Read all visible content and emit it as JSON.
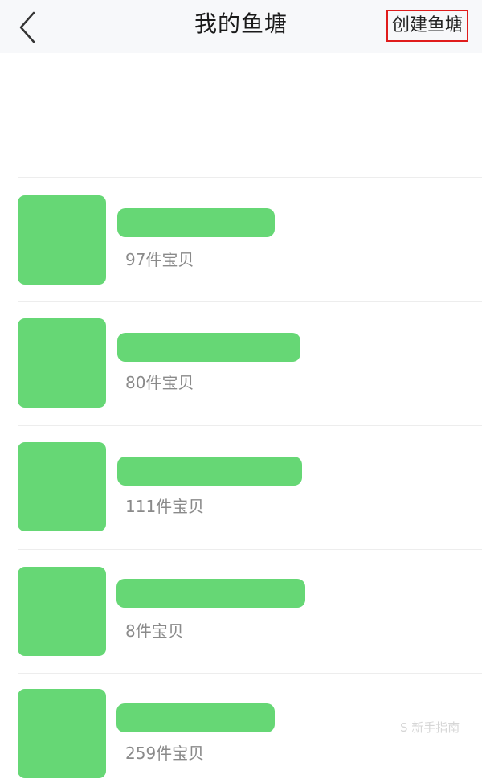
{
  "header": {
    "title": "我的鱼塘",
    "create_label": "创建鱼塘"
  },
  "colors": {
    "placeholder": "#66d775",
    "header_bg": "#f7f8fa",
    "highlight_border": "#e01c1c",
    "muted_text": "#8a8a8a"
  },
  "icons": {
    "back": "chevron-left-icon"
  },
  "ponds": [
    {
      "count": "97件宝贝"
    },
    {
      "count": "80件宝贝"
    },
    {
      "count": "111件宝贝"
    },
    {
      "count": "8件宝贝"
    },
    {
      "count": "259件宝贝"
    }
  ],
  "watermark": "S 新手指南"
}
